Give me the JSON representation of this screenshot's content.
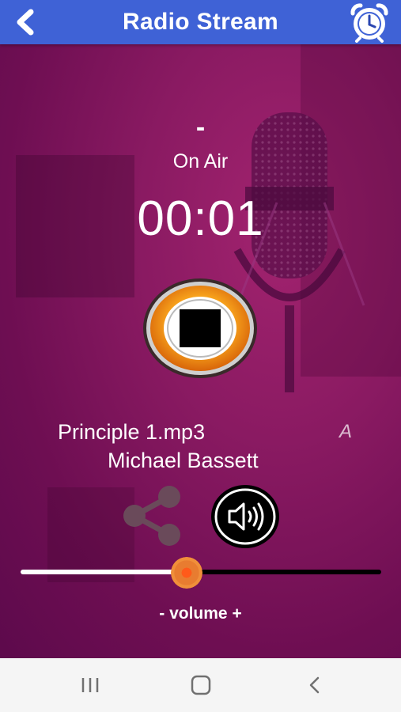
{
  "appbar": {
    "title": "Radio Stream",
    "back_icon": "chevron-left-icon",
    "alarm_icon": "alarm-clock-icon",
    "color": "#3f62d6"
  },
  "player": {
    "track_title": "-",
    "status": "On Air",
    "elapsed": "00:01",
    "stop_icon": "stop-icon",
    "song": "Principle 1.mp3",
    "artist": "Michael Bassett",
    "marquee_fragment": "A",
    "share_icon": "share-icon",
    "speaker_icon": "speaker-icon",
    "background_color": "#8a1a62"
  },
  "volume": {
    "label": "- volume +",
    "level_fraction": 0.46,
    "thumb_color": "#f08f3a"
  },
  "system_nav": {
    "recents_icon": "recents-icon",
    "home_icon": "home-icon",
    "back_icon": "back-icon"
  }
}
